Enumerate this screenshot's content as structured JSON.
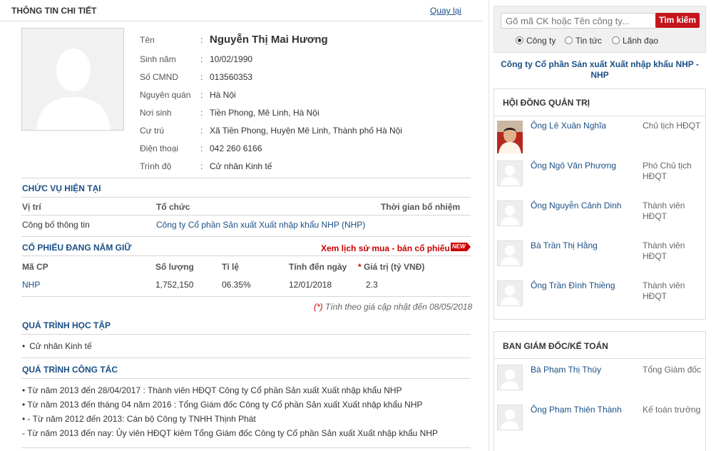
{
  "header": {
    "title": "THÔNG TIN CHI TIẾT",
    "back_link": "Quay lại"
  },
  "profile": {
    "fields": [
      {
        "label": "Tên",
        "value": "Nguyễn Thị Mai Hương"
      },
      {
        "label": "Sinh năm",
        "value": "10/02/1990"
      },
      {
        "label": "Số CMND",
        "value": "013560353"
      },
      {
        "label": "Nguyên quán",
        "value": "Hà Nội"
      },
      {
        "label": "Nơi sinh",
        "value": "Tiền Phong, Mê Linh, Hà Nội"
      },
      {
        "label": "Cư trú",
        "value": "Xã Tiền Phong, Huyện Mê Linh, Thành phố Hà Nội"
      },
      {
        "label": "Điện thoại",
        "value": "042 260 6166"
      },
      {
        "label": "Trình độ",
        "value": "Cử nhân Kinh tế"
      }
    ],
    "colon": ":"
  },
  "position": {
    "title": "CHỨC VỤ HIỆN TẠI",
    "headers": [
      "Vị trí",
      "Tổ chức",
      "Thời gian bổ nhiệm"
    ],
    "row": [
      "Công bố thông tin",
      "Công ty Cổ phần Sản xuất Xuất nhập khẩu NHP (NHP)",
      ""
    ]
  },
  "shares": {
    "title": "CỔ PHIẾU ĐANG NẮM GIỮ",
    "history_link": "Xem lịch sử mua - bán cổ phiếu",
    "new_badge": "NEW",
    "headers": [
      "Mã CP",
      "Số lượng",
      "Tỉ lệ",
      "Tính đến ngày",
      "* Giá trị (tỷ VNĐ)"
    ],
    "header_star": "*",
    "header_value": "Giá trị (tỷ VNĐ)",
    "row": [
      "NHP",
      "1,752,150",
      "06.35%",
      "12/01/2018",
      "2.3"
    ],
    "footnote_star": "(*)",
    "footnote": "Tính theo giá cập nhật đến 08/05/2018"
  },
  "education": {
    "title": "QUÁ TRÌNH HỌC TẬP",
    "items": [
      "Cử nhân Kinh tế"
    ]
  },
  "career": {
    "title": "QUÁ TRÌNH CÔNG TÁC",
    "items": [
      "• Từ năm 2013 đến 28/04/2017 : Thành viên HĐQT Công ty Cổ phần Sản xuất Xuất nhập khẩu NHP",
      "• Từ năm 2013 đến tháng 04 năm 2016 : Tổng Giám đốc Công ty Cổ phần Sản xuất Xuất nhập khẩu NHP",
      "• - Từ năm 2012 đến 2013: Cán bộ Công ty TNHH Thịnh Phát",
      "- Từ năm 2013 đến nay: Ủy viên HĐQT kiêm Tổng Giám đốc Công ty Cổ phần Sản xuất Xuất nhập khẩu NHP"
    ]
  },
  "search": {
    "placeholder": "Gõ mã CK hoặc Tên công ty...",
    "button": "Tìm kiếm",
    "options": [
      "Công ty",
      "Tin tức",
      "Lãnh đạo"
    ],
    "selected": "Công ty"
  },
  "company_name": "Công ty Cổ phần Sản xuất Xuất nhập khẩu NHP - NHP",
  "board": {
    "title": "HỘI ĐỒNG QUẢN TRỊ",
    "members": [
      {
        "name": "Ông Lê Xuân Nghĩa",
        "role": "Chủ tịch HĐQT"
      },
      {
        "name": "Ông Ngô Văn Phương",
        "role": "Phó Chủ tịch HĐQT"
      },
      {
        "name": "Ông Nguyễn Cảnh Dinh",
        "role": "Thành viên HĐQT"
      },
      {
        "name": "Bà Trần Thị Hằng",
        "role": "Thành viên HĐQT"
      },
      {
        "name": "Ông Trần Đình Thiềng",
        "role": "Thành viên HĐQT"
      }
    ]
  },
  "management": {
    "title": "BAN GIÁM ĐỐC/KẾ TOÁN",
    "members": [
      {
        "name": "Bà Phạm Thị Thúy",
        "role": "Tổng Giám đốc"
      },
      {
        "name": "Ông Phạm Thiên Thành",
        "role": "Kế toán trưởng"
      }
    ]
  },
  "colors": {
    "accent": "#1a4f86",
    "red": "#cc0000",
    "search_button": "#c4161c"
  }
}
